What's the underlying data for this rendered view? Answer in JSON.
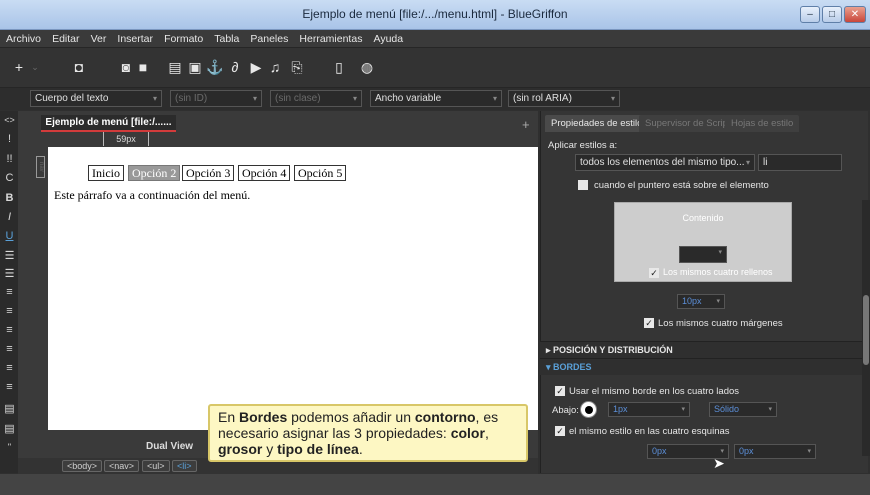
{
  "window": {
    "title": "Ejemplo de menú [file:/.../menu.html] - BlueGriffon",
    "minimize": "–",
    "maximize": "□",
    "close": "✕"
  },
  "menubar": [
    "Archivo",
    "Editar",
    "Ver",
    "Insertar",
    "Formato",
    "Tabla",
    "Paneles",
    "Herramientas",
    "Ayuda"
  ],
  "formatbar": {
    "para_style": "Cuerpo del texto",
    "id_placeholder": "(sin ID)",
    "class_placeholder": "(sin clase)",
    "width": "Ancho variable",
    "aria": "(sin rol ARIA)"
  },
  "editor": {
    "tab_title": "Ejemplo de menú [file:/......",
    "ruler": "59px",
    "nav_label": "nav",
    "menu_items": [
      {
        "label": "Inicio",
        "active": false
      },
      {
        "label": "Opción 2",
        "active": true
      },
      {
        "label": "Opción 3",
        "active": false
      },
      {
        "label": "Opción 4",
        "active": false
      },
      {
        "label": "Opción 5",
        "active": false
      }
    ],
    "paragraph": "Este párrafo va a continuación del menú.",
    "dual_view": "Dual View",
    "breadcrumbs": [
      "<body>",
      "<nav>",
      "<ul>",
      "<li>"
    ]
  },
  "panel": {
    "tabs": [
      "Propiedades de estilo",
      "Supervisor de Scripts",
      "Hojas de estilo"
    ],
    "apply_label": "Aplicar estilos a:",
    "apply_select": "todos los elementos del mismo tipo...",
    "apply_value": "li",
    "hover_label": "cuando el puntero está sobre el elemento",
    "contenido": "Contenido",
    "same_padding": "Los mismos cuatro rellenos",
    "margin_value": "10px",
    "same_margins": "Los mismos cuatro márgenes",
    "section_position": "POSICIÓN Y DISTRIBUCIÓN",
    "section_borders": "BORDES",
    "same_border": "Usar el mismo borde en los cuatro lados",
    "abajo_label": "Abajo:",
    "border_width": "1px",
    "border_style": "Sólido",
    "same_corners": "el mismo estilo en las cuatro esquinas",
    "corner1": "0px",
    "corner2": "0px"
  },
  "callout": {
    "p1": "En ",
    "b1": "Bordes",
    "p2": " podemos añadir un ",
    "b2": "contorno",
    "p3": ", es necesario asignar las 3 propiedades: ",
    "b3": "color",
    "p4": ", ",
    "b4": "grosor",
    "p5": " y ",
    "b5": "tipo de línea",
    "p6": "."
  },
  "colors": {
    "accent": "#5aa0d8",
    "tab_underline": "#d23b3b",
    "callout_bg": "#fdf7c3"
  }
}
